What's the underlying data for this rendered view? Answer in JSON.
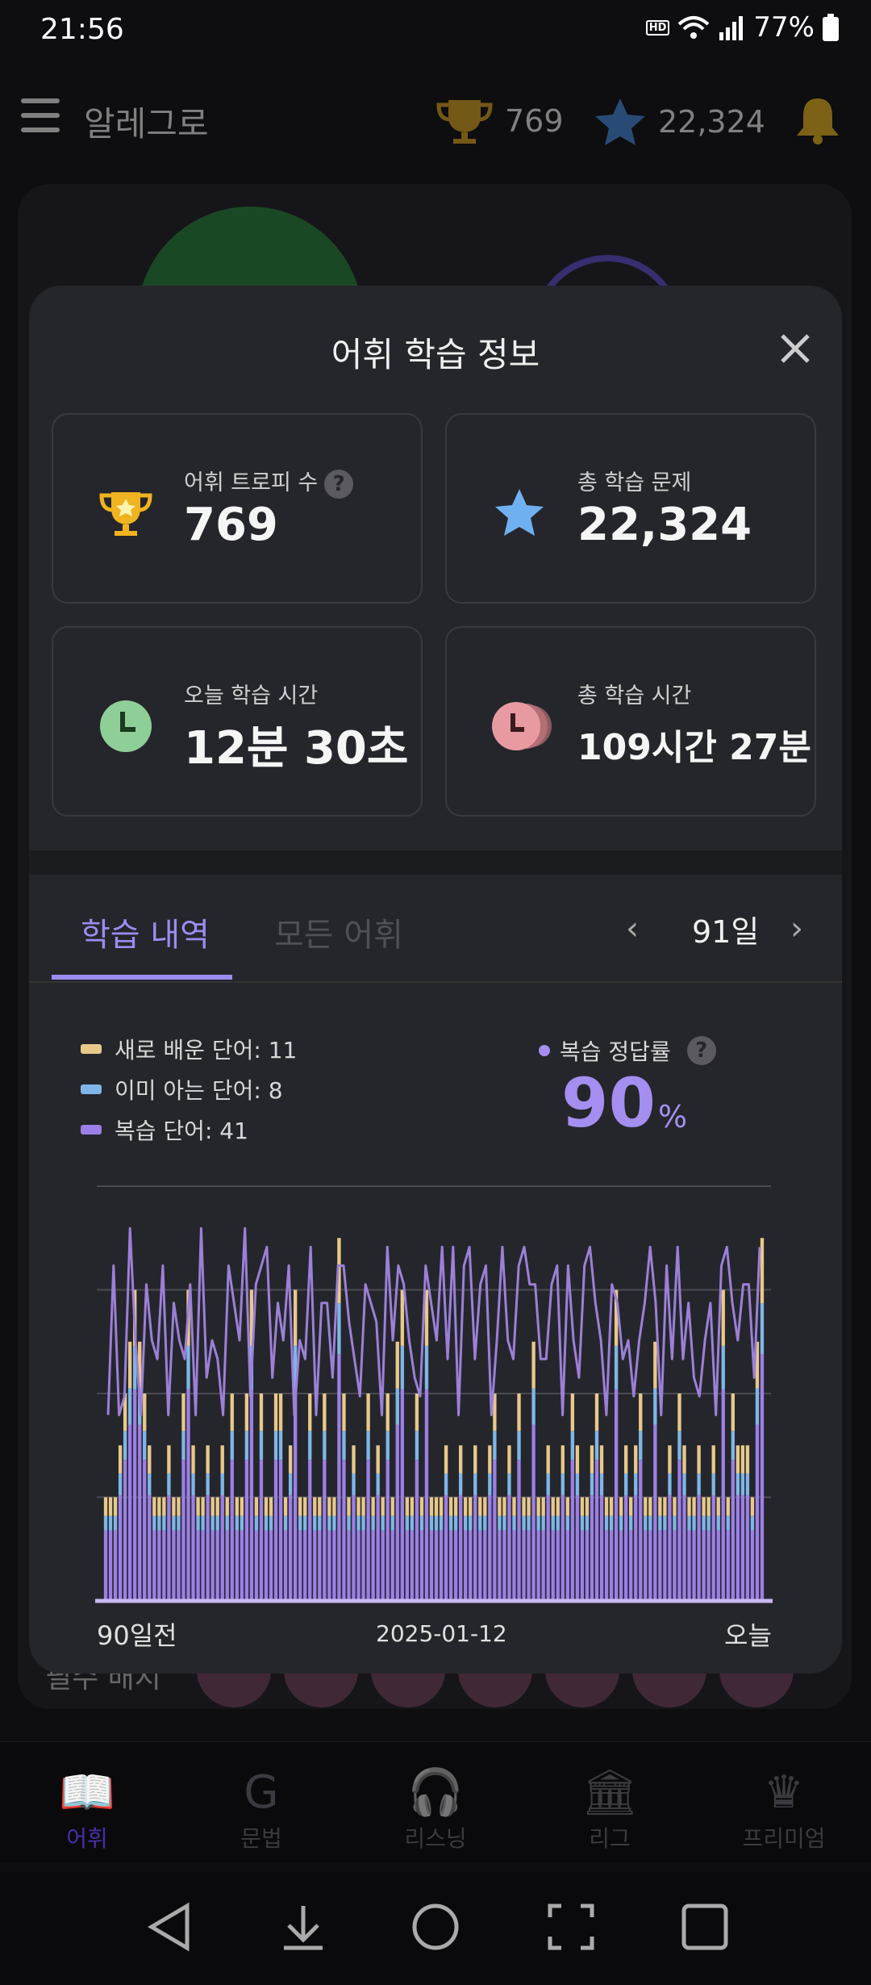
{
  "status": {
    "time": "21:56",
    "hd": "HD",
    "battery": "77%"
  },
  "appbar": {
    "title": "알레그로",
    "trophies": "769",
    "stars": "22,324"
  },
  "background": {
    "text": "필수 배지"
  },
  "modal": {
    "title": "어휘 학습 정보",
    "stats": [
      {
        "label": "어휘 트로피 수",
        "value": "769",
        "icon": "trophy-icon",
        "help": "?"
      },
      {
        "label": "총 학습 문제",
        "value": "22,324",
        "icon": "star-icon"
      },
      {
        "label": "오늘 학습 시간",
        "value": "12분 30초",
        "icon": "clock-icon"
      },
      {
        "label": "총 학습 시간",
        "value": "109시간 27분",
        "icon": "clock-stack-icon"
      }
    ],
    "tabs": [
      {
        "label": "학습 내역"
      },
      {
        "label": "모든 어휘"
      }
    ],
    "period": "91일",
    "legend": [
      {
        "label": "새로 배운 단어: 11",
        "color": "#e8c98a"
      },
      {
        "label": "이미 아는 단어: 8",
        "color": "#7fb6e8"
      },
      {
        "label": "복습 단어: 41",
        "color": "#9c7fe6"
      }
    ],
    "accuracy": {
      "label": "복습 정답률",
      "value": "90",
      "unit": "%",
      "help": "?"
    }
  },
  "chart_data": {
    "type": "bar",
    "stacked": true,
    "series_colors": {
      "new": "#e8c98a",
      "known": "#7fb6e8",
      "review": "#9c7fe6",
      "line": "#9b80d8"
    },
    "x_labels": [
      "90일전",
      "2025-01-12",
      "오늘"
    ],
    "grid": true,
    "days": 91,
    "ylim": [
      0,
      80
    ],
    "totals": [
      20,
      20,
      20,
      30,
      40,
      50,
      60,
      50,
      40,
      30,
      20,
      20,
      20,
      30,
      20,
      20,
      40,
      60,
      30,
      20,
      20,
      30,
      20,
      20,
      30,
      20,
      40,
      20,
      20,
      40,
      60,
      20,
      40,
      20,
      20,
      40,
      40,
      20,
      30,
      60,
      20,
      20,
      40,
      20,
      20,
      40,
      20,
      20,
      70,
      40,
      20,
      30,
      20,
      20,
      40,
      20,
      30,
      20,
      40,
      20,
      50,
      60,
      20,
      20,
      40,
      20,
      60,
      20,
      20,
      20,
      30,
      20,
      20,
      30,
      20,
      20,
      30,
      20,
      20,
      30,
      40,
      20,
      20,
      30,
      20,
      40,
      20,
      20,
      50,
      20,
      20,
      30,
      20,
      20,
      30,
      20,
      40,
      30,
      20,
      20,
      30,
      40,
      30,
      20,
      20,
      60,
      20,
      30,
      20,
      30,
      40,
      20,
      20,
      50,
      20,
      20,
      30,
      20,
      40,
      30,
      20,
      20,
      30,
      20,
      20,
      30,
      20,
      60,
      20,
      40,
      30,
      30,
      30,
      20,
      50,
      70
    ],
    "accuracy_line": [
      40,
      80,
      40,
      45,
      90,
      60,
      40,
      75,
      60,
      55,
      80,
      40,
      70,
      60,
      55,
      75,
      40,
      90,
      50,
      60,
      55,
      40,
      80,
      70,
      60,
      90,
      45,
      75,
      80,
      85,
      50,
      70,
      60,
      80,
      40,
      60,
      55,
      85,
      40,
      70,
      70,
      50,
      80,
      80,
      65,
      55,
      45,
      75,
      70,
      65,
      40,
      85,
      60,
      80,
      75,
      60,
      50,
      45,
      80,
      70,
      60,
      85,
      55,
      85,
      40,
      80,
      85,
      55,
      75,
      80,
      40,
      60,
      85,
      60,
      55,
      80,
      85,
      75,
      75,
      55,
      55,
      75,
      80,
      40,
      80,
      60,
      50,
      80,
      85,
      70,
      60,
      40,
      75,
      70,
      55,
      60,
      45,
      60,
      70,
      85,
      70,
      40,
      80,
      55,
      85,
      55,
      70,
      50,
      45,
      60,
      70,
      40,
      80,
      85,
      70,
      60,
      75,
      75,
      50,
      85
    ]
  }
}
